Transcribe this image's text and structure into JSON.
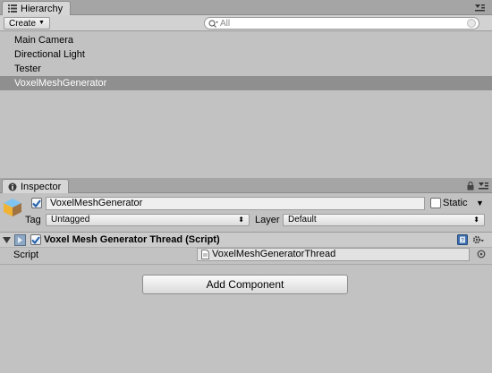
{
  "hierarchy": {
    "tab_label": "Hierarchy",
    "create_label": "Create",
    "search_placeholder": "All",
    "items": [
      {
        "label": "Main Camera",
        "selected": false
      },
      {
        "label": "Directional Light",
        "selected": false
      },
      {
        "label": "Tester",
        "selected": false
      },
      {
        "label": "VoxelMeshGenerator",
        "selected": true
      }
    ]
  },
  "inspector": {
    "tab_label": "Inspector",
    "object_name": "VoxelMeshGenerator",
    "active_checked": true,
    "static_label": "Static",
    "static_checked": false,
    "tag_label": "Tag",
    "tag_value": "Untagged",
    "layer_label": "Layer",
    "layer_value": "Default",
    "component": {
      "title": "Voxel Mesh Generator Thread (Script)",
      "enabled": true,
      "script_label": "Script",
      "script_value": "VoxelMeshGeneratorThread"
    },
    "add_component_label": "Add Component"
  },
  "colors": {
    "panel_bg": "#c2c2c2",
    "tabstrip_bg": "#a5a5a5",
    "selection_bg": "#8f8f8f",
    "checkbox_mark": "#1f5ea8"
  }
}
